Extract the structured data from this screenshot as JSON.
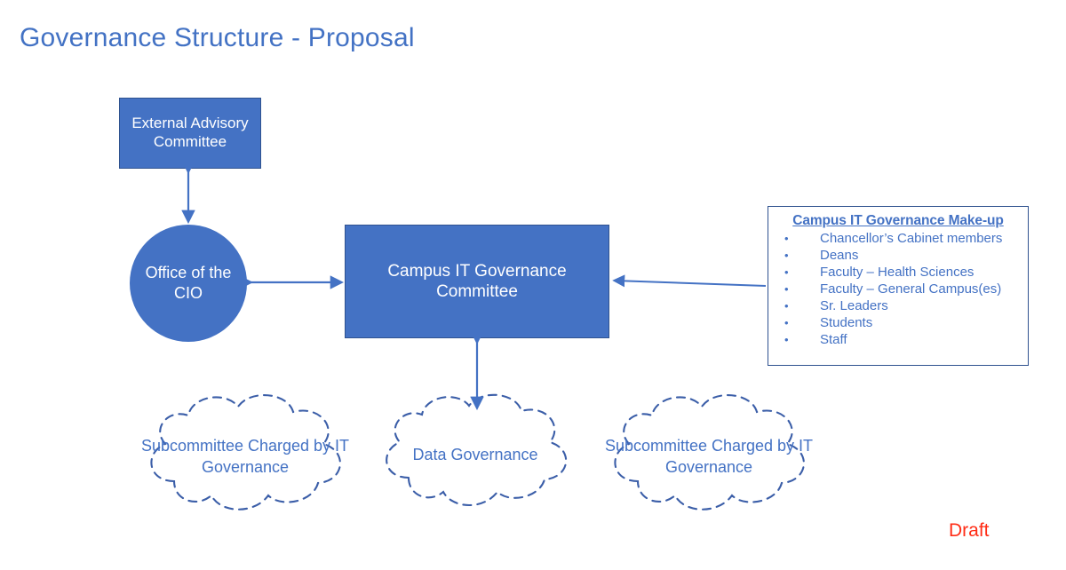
{
  "slide": {
    "title": "Governance Structure - Proposal",
    "draft_label": "Draft",
    "accent_blue": "#4472C4",
    "accent_blue_dark": "#2F528F",
    "draft_color": "#FF2D16",
    "background": "#FFFFFF"
  },
  "nodes": {
    "external_advisory": {
      "label": "External Advisory Committee",
      "shape": "rectangle",
      "fill": "#4472C4",
      "text_color": "#FFFFFF"
    },
    "office_cio": {
      "label": "Office of the CIO",
      "shape": "circle",
      "fill": "#4472C4",
      "text_color": "#FFFFFF"
    },
    "campus_it_governance": {
      "label": "Campus IT Governance Committee",
      "shape": "rectangle",
      "fill": "#4472C4",
      "text_color": "#FFFFFF"
    }
  },
  "clouds": [
    {
      "id": "subcommittee-left",
      "label": "Subcommittee Charged by IT Governance",
      "shape": "cloud",
      "outline": "dashed",
      "outline_color": "#3B5EA8",
      "text_color": "#4472C4"
    },
    {
      "id": "data-governance",
      "label": "Data Governance",
      "shape": "cloud",
      "outline": "dashed",
      "outline_color": "#3B5EA8",
      "text_color": "#4472C4"
    },
    {
      "id": "subcommittee-right",
      "label": "Subcommittee Charged by IT Governance",
      "shape": "cloud",
      "outline": "dashed",
      "outline_color": "#3B5EA8",
      "text_color": "#4472C4"
    }
  ],
  "makeup_panel": {
    "title": "Campus IT Governance Make-up",
    "bullet_glyph": "•",
    "items": [
      "Chancellor’s Cabinet members",
      "Deans",
      "Faculty – Health Sciences",
      "Faculty – General Campus(es)",
      "Sr. Leaders",
      "Students",
      "Staff"
    ]
  },
  "connectors": [
    {
      "id": "ext-advisory-to-cio",
      "from": "external_advisory",
      "to": "office_cio",
      "style": "double-headed",
      "orientation": "vertical"
    },
    {
      "id": "cio-to-campus",
      "from": "office_cio",
      "to": "campus_it_governance",
      "style": "double-headed",
      "orientation": "horizontal"
    },
    {
      "id": "makeup-to-campus",
      "from": "makeup_panel",
      "to": "campus_it_governance",
      "style": "single-headed",
      "orientation": "horizontal"
    },
    {
      "id": "campus-to-data-governance",
      "from": "campus_it_governance",
      "to": "data-governance",
      "style": "double-headed",
      "orientation": "vertical"
    }
  ]
}
